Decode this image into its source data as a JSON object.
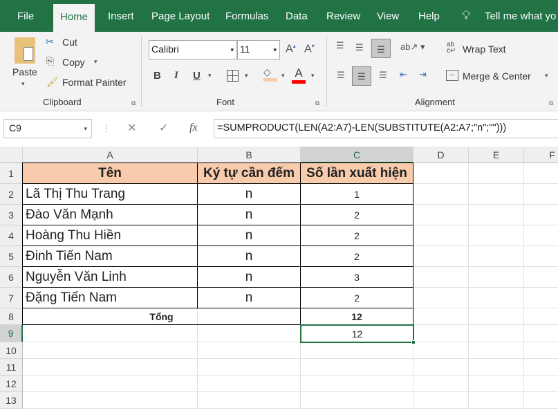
{
  "tabs": [
    "File",
    "Home",
    "Insert",
    "Page Layout",
    "Formulas",
    "Data",
    "Review",
    "View",
    "Help",
    "Tell me what yo"
  ],
  "clipboard": {
    "paste": "Paste",
    "cut": "Cut",
    "copy": "Copy",
    "format_painter": "Format Painter",
    "label": "Clipboard"
  },
  "font": {
    "name": "Calibri",
    "size": "11",
    "bold": "B",
    "italic": "I",
    "underline": "U",
    "label": "Font",
    "fill_color": "#f8cbad",
    "font_color": "#ff0000"
  },
  "alignment": {
    "wrap": "Wrap Text",
    "merge": "Merge & Center",
    "label": "Alignment"
  },
  "formula_bar": {
    "name_box": "C9",
    "fx": "fx",
    "formula": "=SUMPRODUCT(LEN(A2:A7)-LEN(SUBSTITUTE(A2:A7;\"n\";\"\")))"
  },
  "columns": [
    "A",
    "B",
    "C",
    "D",
    "E",
    "F"
  ],
  "rows": [
    "1",
    "2",
    "3",
    "4",
    "5",
    "6",
    "7",
    "8",
    "9",
    "10",
    "11",
    "12",
    "13"
  ],
  "table": {
    "headers": [
      "Tên",
      "Ký tự cần đếm",
      "Số lần xuất hiện"
    ],
    "header_fill": "#f8cbad",
    "data": [
      [
        "Lã Thị Thu Trang",
        "n",
        "1"
      ],
      [
        "Đào Văn Mạnh",
        "n",
        "2"
      ],
      [
        "Hoàng Thu Hiền",
        "n",
        "2"
      ],
      [
        "Đinh Tiến Nam",
        "n",
        "2"
      ],
      [
        "Nguyễn Văn Linh",
        "n",
        "3"
      ],
      [
        "Đặng Tiến Nam",
        "n",
        "2"
      ]
    ],
    "total_label": "Tổng",
    "total_value": "12",
    "c9_value": "12"
  }
}
